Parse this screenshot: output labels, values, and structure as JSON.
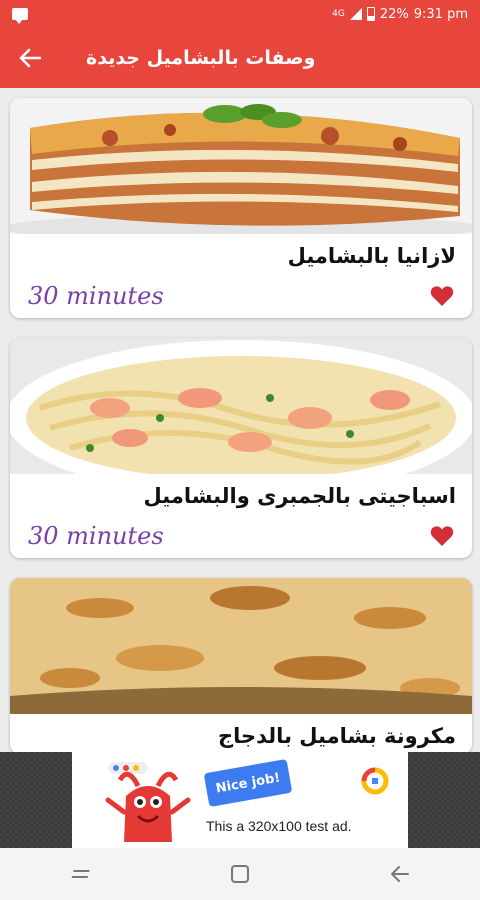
{
  "status_bar": {
    "network": "4G",
    "battery": "22%",
    "time": "9:31 pm"
  },
  "app_bar": {
    "title": "وصفات بالبشاميل جديدة",
    "back_icon": "arrow-left-icon"
  },
  "recipes": [
    {
      "title": "لازانيا بالبشاميل",
      "time": "30 minutes",
      "favorite": true
    },
    {
      "title": "اسباجيتى بالجمبرى والبشاميل",
      "time": "30 minutes",
      "favorite": true
    },
    {
      "title": "مكرونة بشاميل بالدجاج",
      "time": "",
      "favorite": false
    }
  ],
  "ad": {
    "badge": "Nice job!",
    "text": "This a 320x100 test ad."
  },
  "colors": {
    "primary": "#e8453c",
    "heart": "#d32f3b",
    "time_text": "#7b3fa6"
  }
}
